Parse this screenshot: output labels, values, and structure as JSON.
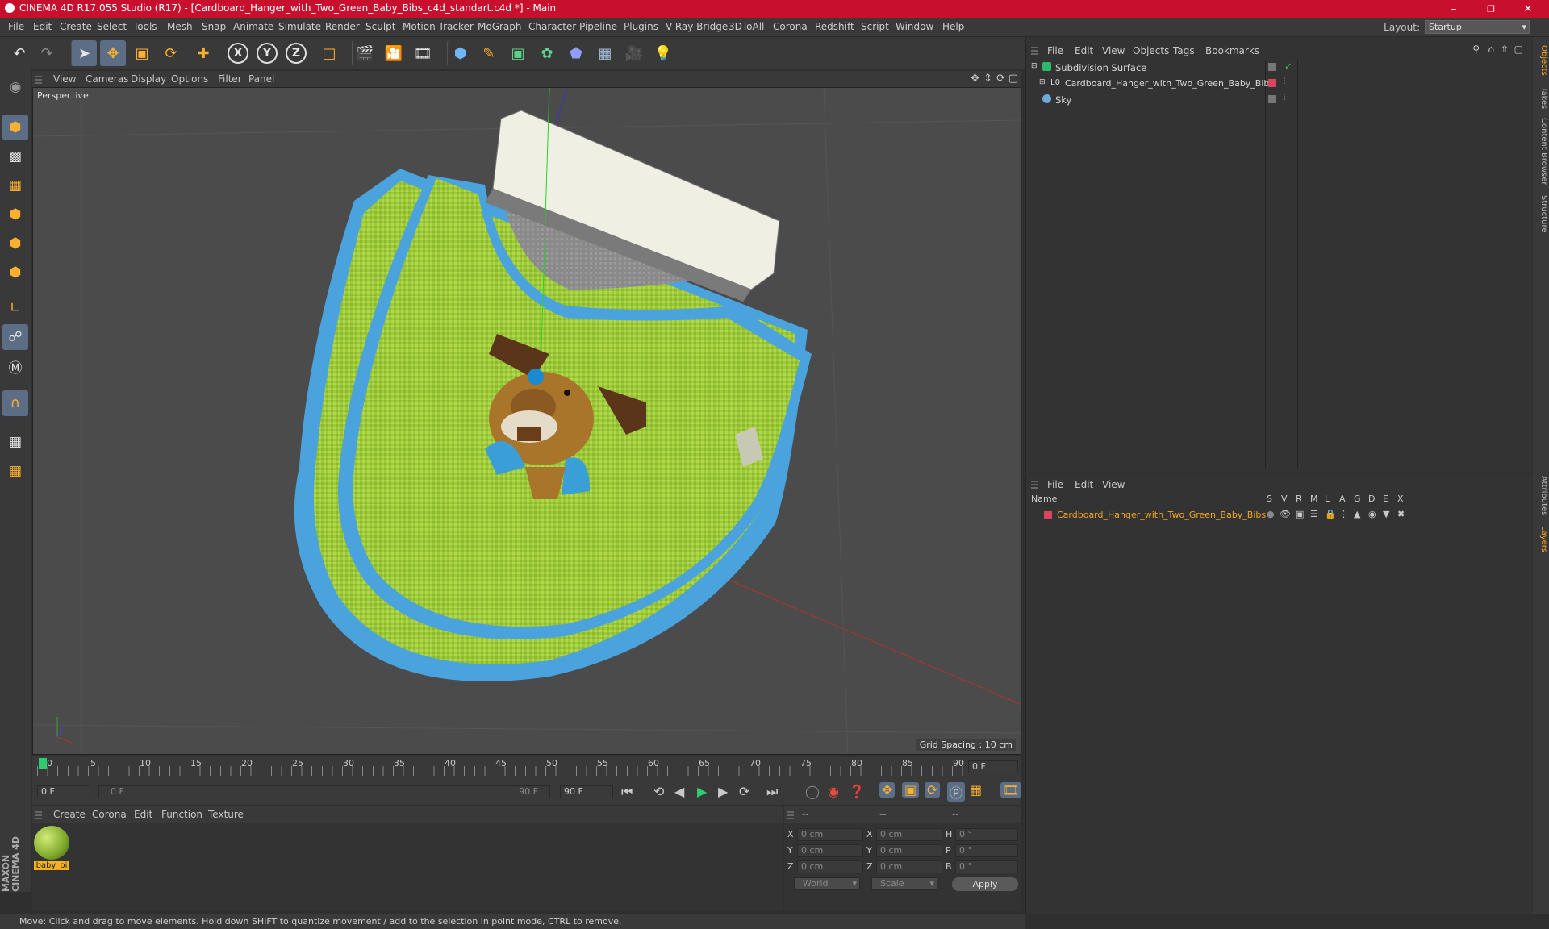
{
  "window": {
    "title": "CINEMA 4D R17.055 Studio (R17) - [Cardboard_Hanger_with_Two_Green_Baby_Bibs_c4d_standart.c4d *] - Main",
    "minimize": "–",
    "restore": "❐",
    "close": "✕"
  },
  "menubar": {
    "items": [
      "File",
      "Edit",
      "Create",
      "Select",
      "Tools",
      "Mesh",
      "Snap",
      "Animate",
      "Simulate",
      "Render",
      "Sculpt",
      "Motion Tracker",
      "MoGraph",
      "Character",
      "Pipeline",
      "Plugins",
      "V-Ray Bridge",
      "3DToAll",
      "Corona",
      "Redshift",
      "Script",
      "Window",
      "Help"
    ],
    "layout_label": "Layout:",
    "layout_value": "Startup"
  },
  "toolbar": {
    "axis_x": "X",
    "axis_y": "Y",
    "axis_z": "Z"
  },
  "viewport": {
    "menu": [
      "View",
      "Cameras",
      "Display",
      "Options",
      "Filter",
      "Panel"
    ],
    "label": "Perspective",
    "grid_spacing": "Grid Spacing : 10 cm"
  },
  "timeline": {
    "ticks": [
      "0",
      "5",
      "10",
      "15",
      "20",
      "25",
      "30",
      "35",
      "40",
      "45",
      "50",
      "55",
      "60",
      "65",
      "70",
      "75",
      "80",
      "85",
      "90"
    ],
    "current_frame": "0 F",
    "start_field": "0 F",
    "range_start": "0 F",
    "range_end": "90 F",
    "end_field": "90 F"
  },
  "material_panel": {
    "menu": [
      "Create",
      "Corona",
      "Edit",
      "Function",
      "Texture"
    ],
    "materials": [
      {
        "name": "baby_bi"
      }
    ]
  },
  "coords": {
    "header": [
      "--",
      "--",
      "--"
    ],
    "rows": [
      {
        "a": "X",
        "av": "0 cm",
        "b": "X",
        "bv": "0 cm",
        "c": "H",
        "cv": "0 °"
      },
      {
        "a": "Y",
        "av": "0 cm",
        "b": "Y",
        "bv": "0 cm",
        "c": "P",
        "cv": "0 °"
      },
      {
        "a": "Z",
        "av": "0 cm",
        "b": "Z",
        "bv": "0 cm",
        "c": "B",
        "cv": "0 °"
      }
    ],
    "world": "World",
    "scale": "Scale",
    "apply": "Apply"
  },
  "statusbar": {
    "text": "Move: Click and drag to move elements. Hold down SHIFT to quantize movement / add to the selection in point mode, CTRL to remove."
  },
  "object_manager": {
    "menu": [
      "File",
      "Edit",
      "View",
      "Objects",
      "Tags",
      "Bookmarks"
    ],
    "objects": [
      {
        "name": "Subdivision Surface",
        "color": "#2fb86a"
      },
      {
        "name": "Cardboard_Hanger_with_Two_Green_Baby_Bibs",
        "color": "#e0e0e0"
      },
      {
        "name": "Sky",
        "color": "#6fa8dc"
      }
    ]
  },
  "layer_manager": {
    "menu": [
      "File",
      "Edit",
      "View"
    ],
    "columns": [
      "Name",
      "S",
      "V",
      "R",
      "M",
      "L",
      "A",
      "G",
      "D",
      "E",
      "X"
    ],
    "layers": [
      {
        "name": "Cardboard_Hanger_with_Two_Green_Baby_Bibs",
        "color": "#d9455f"
      }
    ]
  },
  "right_tabs": [
    "Objects",
    "Takes",
    "Content Browser",
    "Structure",
    "Attributes",
    "Layers"
  ],
  "brand": "MAXON CINEMA 4D"
}
